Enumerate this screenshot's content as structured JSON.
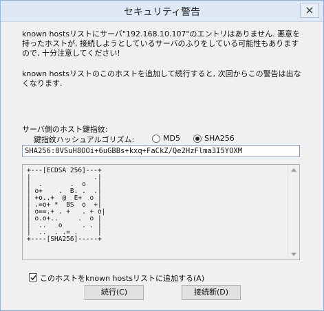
{
  "window": {
    "title": "セキュリティ警告"
  },
  "message": {
    "line1": "known hostsリストにサーバ\"192.168.10.107\"のエントリはありません. 悪意を持ったホストが, 接続しようとしているサーバのふりをしている可能性もありますので, 十分注意してください!",
    "line2": "known hostsリストのこのホストを追加して続行すると, 次回からこの警告は出なくなります."
  },
  "hostkey": {
    "label": "サーバ側のホスト鍵指紋:",
    "hash_label": "鍵指紋ハッシュアルゴリズム:",
    "options": [
      {
        "label": "MD5",
        "selected": false
      },
      {
        "label": "SHA256",
        "selected": true
      }
    ],
    "fingerprint": "SHA256:8VSuH8OOi+6uGBBs+kxq+FaCkZ/Qe2HzFlma3I5YOXM",
    "randomart": "+---[ECDSA 256]---+\n|                .|\n|  .       .  o   |\n| o+    .  B. .  .|\n| +o..+  @  E+  o |\n| .=o+ *  BS  o  +|\n| o==.+ . +   . + o|\n| o.o+..     .  o |\n|  ..   o     . . |\n|  ..  . .= .     |\n+----[SHA256]-----+"
  },
  "checkbox": {
    "label": "このホストをknown hostsリストに追加する(A)",
    "checked": true
  },
  "buttons": {
    "continue": "続行(C)",
    "disconnect": "接続断(D)"
  }
}
